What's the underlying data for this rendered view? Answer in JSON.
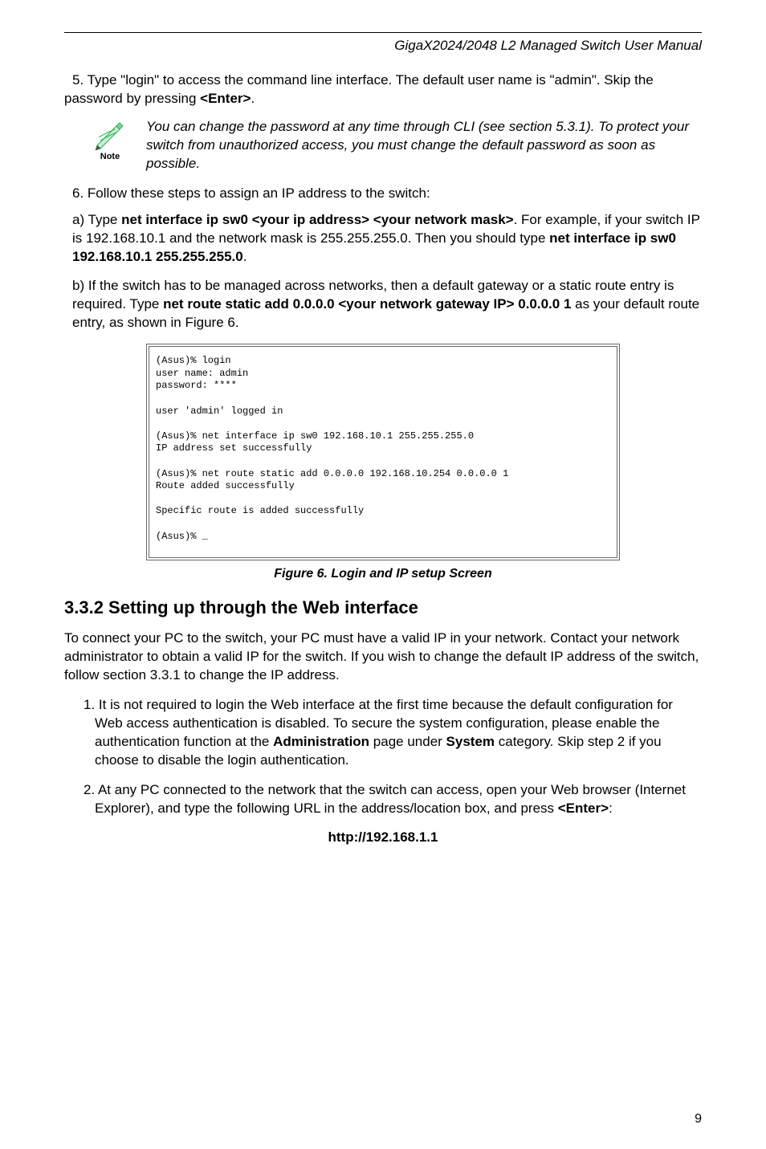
{
  "header": {
    "title": "GigaX2024/2048 L2 Managed Switch User Manual"
  },
  "step5": "5. Type \"login\" to access the command line interface. The default user name is \"admin\". Skip the password by pressing ",
  "step5_bold": "<Enter>",
  "step5_end": ".",
  "note": {
    "label": "Note",
    "text": "You can change the password at any time through CLI (see section 5.3.1). To protect your switch from unauthorized access, you must change the default password as soon as possible."
  },
  "step6": "6. Follow these steps to assign an IP address to the switch:",
  "step_a": {
    "prefix": "a) Type ",
    "bold1": "net interface ip sw0 <your ip address> <your network mask>",
    "mid": ". For example, if your switch IP is 192.168.10.1 and the network mask is 255.255.255.0. Then you should type ",
    "bold2": "net interface ip sw0 192.168.10.1 255.255.255.0",
    "end": "."
  },
  "step_b": {
    "prefix": "b) If the switch has to be managed across networks, then a default gateway or a static route entry is required. Type ",
    "bold1": "net route static add 0.0.0.0 <your network gateway IP> 0.0.0.0 1",
    "mid": " as your default route entry, as shown in Figure 6."
  },
  "terminal": "(Asus)% login\nuser name: admin\npassword: ****\n\nuser 'admin' logged in\n\n(Asus)% net interface ip sw0 192.168.10.1 255.255.255.0\nIP address set successfully\n\n(Asus)% net route static add 0.0.0.0 192.168.10.254 0.0.0.0 1\nRoute added successfully\n\nSpecific route is added successfully\n\n(Asus)% _",
  "figure_caption": "Figure 6. Login and IP setup Screen",
  "section_heading": "3.3.2 Setting up through the Web interface",
  "intro_paragraph": "To connect your PC to the switch, your PC must have a valid IP in your network. Contact your network administrator to obtain a valid IP for the switch. If you wish to change the default IP address of the switch, follow section 3.3.1 to change the IP address.",
  "item1": {
    "prefix": "1. It is not required to login the Web interface at the first time because the default configuration for Web access authentication is disabled. To secure the system configuration, please enable the authentication function at the ",
    "bold1": "Administration",
    "mid": " page under ",
    "bold2": "System",
    "end": " category. Skip step 2 if you choose to disable the login authentication."
  },
  "item2": {
    "prefix": "2. At any PC connected to the network that the switch can access, open your Web browser (Internet Explorer), and type the following URL in the address/location box, and press ",
    "bold1": "<Enter>",
    "end": ":"
  },
  "url": "http://192.168.1.1",
  "page_number": "9"
}
